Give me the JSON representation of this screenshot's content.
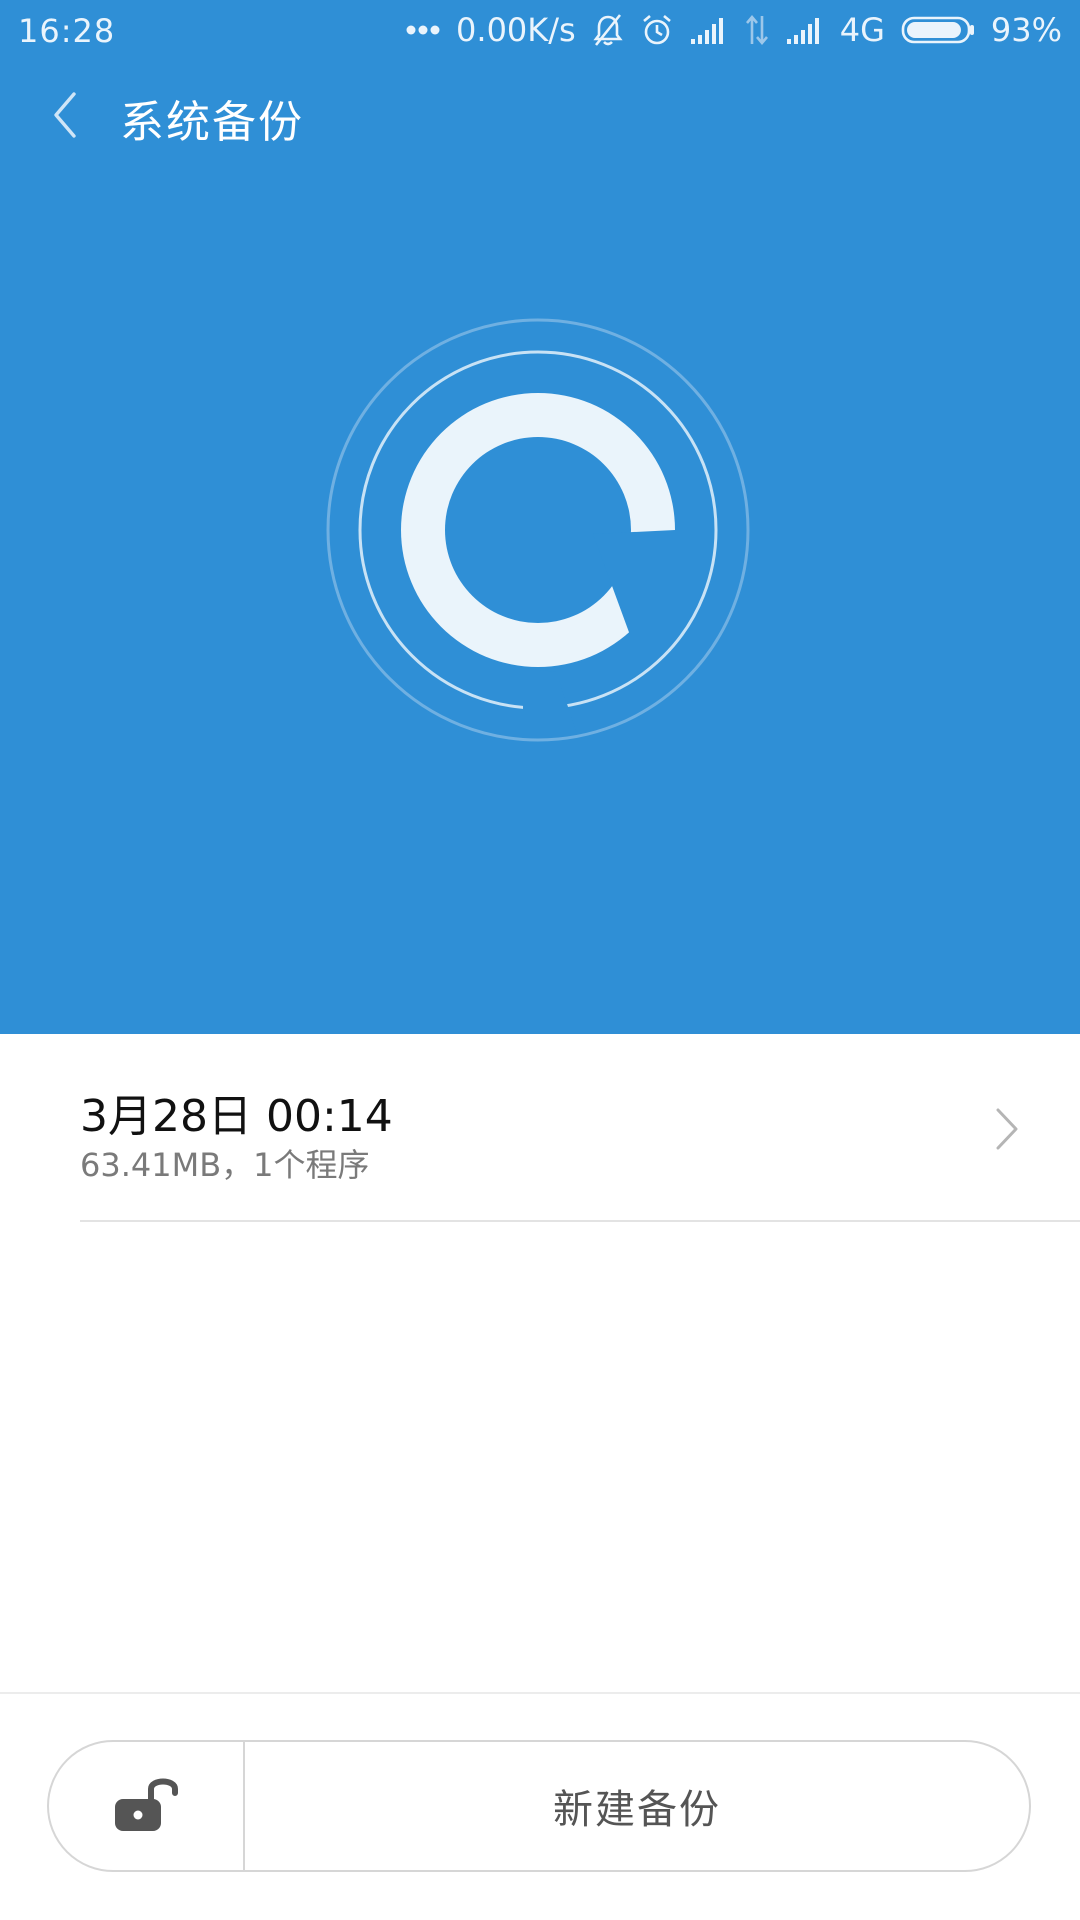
{
  "status_bar": {
    "time": "16:28",
    "net_speed": "0.00K/s",
    "network_type": "4G",
    "battery_percent": "93%",
    "battery_level": 0.93,
    "icons": [
      "more-dots-icon",
      "bell-muted-icon",
      "alarm-icon",
      "signal-icon",
      "data-transfer-icon",
      "signal-icon",
      "battery-icon"
    ]
  },
  "header": {
    "title": "系统备份",
    "back_icon": "chevron-left-icon"
  },
  "hero": {
    "logo_icon": "backup-restore-logo-icon"
  },
  "backups": [
    {
      "title": "3月28日 00:14",
      "subtitle": "63.41MB，1个程序",
      "icon": "chevron-right-icon"
    }
  ],
  "bottom_bar": {
    "lock_icon": "unlock-icon",
    "new_backup_label": "新建备份"
  },
  "colors": {
    "accent": "#2f8fd6",
    "logo_fill": "#eaf4fb",
    "text_primary": "#111111",
    "text_secondary": "#7a7a7a"
  }
}
